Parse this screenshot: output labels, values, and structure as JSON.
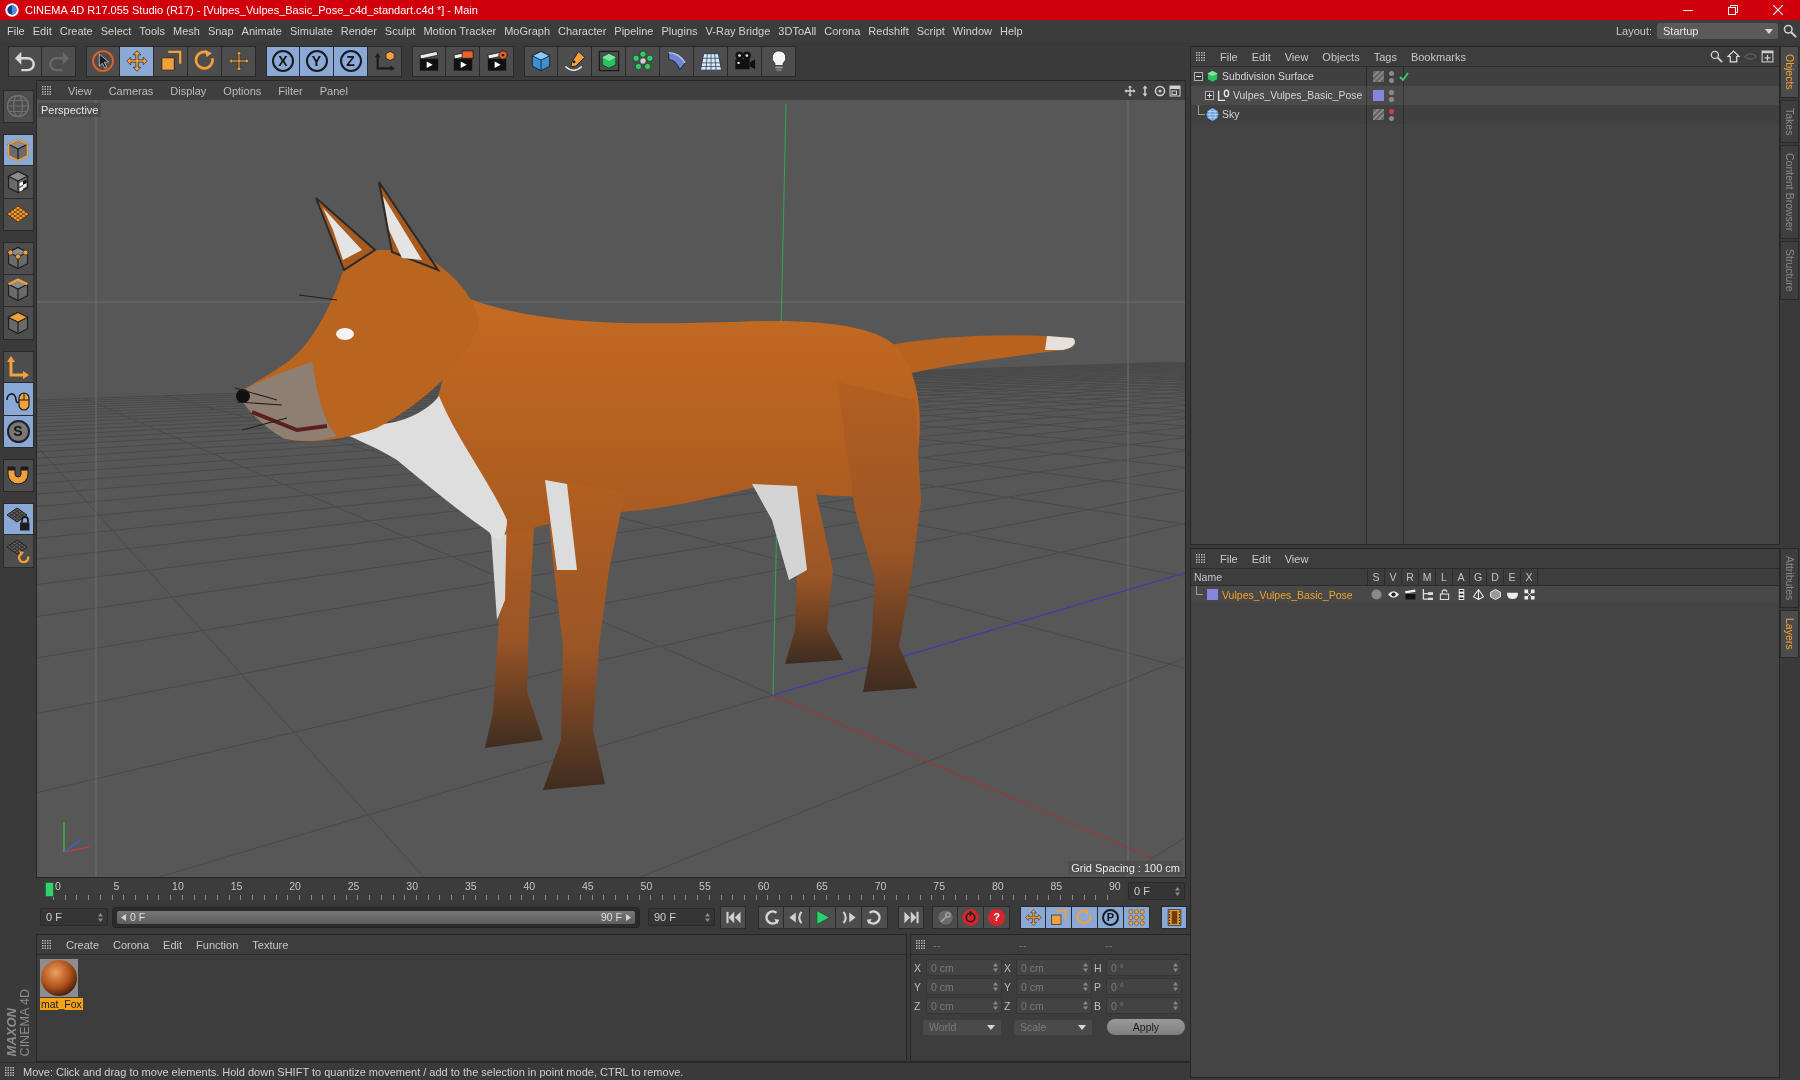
{
  "window": {
    "title": "CINEMA 4D R17.055 Studio (R17) - [Vulpes_Vulpes_Basic_Pose_c4d_standart.c4d *] - Main"
  },
  "menu_bar": [
    "File",
    "Edit",
    "Create",
    "Select",
    "Tools",
    "Mesh",
    "Snap",
    "Animate",
    "Simulate",
    "Render",
    "Sculpt",
    "Motion Tracker",
    "MoGraph",
    "Character",
    "Pipeline",
    "Plugins",
    "V-Ray Bridge",
    "3DToAll",
    "Corona",
    "Redshift",
    "Script",
    "Window",
    "Help"
  ],
  "layout": {
    "label": "Layout:",
    "value": "Startup"
  },
  "toolbar": [
    {
      "buttons": [
        {
          "selected": false,
          "disabled": false
        },
        {
          "selected": false,
          "disabled": true
        }
      ]
    },
    {
      "buttons": [
        {
          "selected": false
        },
        {
          "selected": true
        },
        {
          "selected": false
        },
        {
          "selected": false
        },
        {
          "selected": false
        }
      ]
    },
    {
      "buttons": [
        {
          "label": "X",
          "selected": true
        },
        {
          "label": "Y",
          "selected": true
        },
        {
          "label": "Z",
          "selected": true
        },
        {
          "selected": false
        }
      ]
    },
    {
      "buttons": [
        {
          "selected": false
        },
        {
          "selected": false
        },
        {
          "selected": false
        }
      ]
    },
    {
      "buttons": [
        {
          "selected": false
        },
        {
          "selected": false
        },
        {
          "selected": false
        },
        {
          "selected": false
        },
        {
          "selected": false
        },
        {
          "selected": false
        },
        {
          "selected": false
        },
        {
          "selected": false
        }
      ]
    }
  ],
  "mode_toolbar": [
    {
      "buttons": [
        {
          "selected": false,
          "disabled": true
        }
      ]
    },
    {
      "buttons": [
        {
          "selected": true
        },
        {
          "selected": false
        },
        {
          "selected": false
        }
      ]
    },
    {
      "buttons": [
        {
          "selected": false
        },
        {
          "selected": false
        },
        {
          "selected": false
        }
      ]
    },
    {
      "buttons": [
        {
          "selected": false
        },
        {
          "selected": true
        },
        {
          "label": "S",
          "selected": true
        }
      ]
    },
    {
      "buttons": [
        {
          "selected": false
        }
      ]
    },
    {
      "buttons": [
        {
          "selected": true
        },
        {
          "selected": false
        }
      ]
    }
  ],
  "brand": {
    "company": "MAXON",
    "product": "CINEMA 4D"
  },
  "viewport": {
    "menu": [
      "View",
      "Cameras",
      "Display",
      "Options",
      "Filter",
      "Panel"
    ],
    "camera": "Perspective",
    "grid_spacing": "Grid Spacing : 100 cm"
  },
  "timeline": {
    "ticks": [
      "0",
      "5",
      "10",
      "15",
      "20",
      "25",
      "30",
      "35",
      "40",
      "45",
      "50",
      "55",
      "60",
      "65",
      "70",
      "75",
      "80",
      "85",
      "90"
    ],
    "level": 0,
    "current_frame": "0 F"
  },
  "transport": {
    "start": "0 F",
    "range_start": "0 F",
    "range_end": "90 F",
    "end": "90 F",
    "level": 1,
    "groups": [
      {
        "buttons": [
          {
            "selected": false
          }
        ]
      },
      {
        "buttons": [
          {
            "selected": false
          },
          {
            "selected": false
          },
          {
            "selected": false
          },
          {
            "selected": false
          },
          {
            "selected": false
          }
        ]
      },
      {
        "buttons": [
          {
            "selected": false
          }
        ]
      },
      {
        "buttons": [
          {
            "selected": false
          },
          {
            "selected": false
          },
          {
            "label": "?",
            "selected": false
          }
        ]
      },
      {
        "buttons": [
          {
            "selected": true
          },
          {
            "selected": true
          },
          {
            "selected": true
          },
          {
            "label": "P",
            "selected": true
          },
          {
            "selected": true
          }
        ]
      },
      {
        "buttons": [
          {
            "selected": true
          }
        ]
      }
    ]
  },
  "materials": {
    "menu": [
      "Create",
      "Corona",
      "Edit",
      "Function",
      "Texture"
    ],
    "items": [
      {
        "name": "mat_Fox",
        "selected": true
      }
    ]
  },
  "coordinates": {
    "disabled": true,
    "columns": [
      "--",
      "--",
      "--"
    ],
    "rows": [
      {
        "axis": "X",
        "position": "0 cm",
        "size_axis": "X",
        "size": "0 cm",
        "rotation_axis": "H",
        "rotation": "0 °"
      },
      {
        "axis": "Y",
        "position": "0 cm",
        "size_axis": "Y",
        "size": "0 cm",
        "rotation_axis": "P",
        "rotation": "0 °"
      },
      {
        "axis": "Z",
        "position": "0 cm",
        "size_axis": "Z",
        "size": "0 cm",
        "rotation_axis": "B",
        "rotation": "0 °"
      }
    ],
    "mode": "World",
    "size_mode": "Scale",
    "apply": "Apply"
  },
  "status_bar": "Move: Click and drag to move elements. Hold down SHIFT to quantize movement / add to the selection in point mode, CTRL to remove.",
  "objects": {
    "menu": [
      "File",
      "Edit",
      "View",
      "Objects",
      "Tags",
      "Bookmarks"
    ],
    "tree": [
      {
        "name": "Subdivision Surface",
        "kind": "subdivision",
        "expanded": true,
        "editor_hidden": false,
        "enabled": true,
        "children": [
          {
            "name": "Vulpes_Vulpes_Basic_Pose",
            "kind": "null",
            "expanded": false,
            "editor_hidden": false,
            "color": "#8585de"
          }
        ]
      },
      {
        "name": "Sky",
        "kind": "sky",
        "editor_hidden": true
      }
    ]
  },
  "layers": {
    "menu": [
      "File",
      "Edit",
      "View"
    ],
    "columns": [
      "Name",
      "S",
      "V",
      "R",
      "M",
      "L",
      "A",
      "G",
      "D",
      "E",
      "X"
    ],
    "rows": [
      {
        "name": "Vulpes_Vulpes_Basic_Pose",
        "color": "#8585de",
        "selected": true
      }
    ]
  },
  "side_tabs": {
    "top": [
      {
        "label": "Objects",
        "selected": true
      },
      {
        "label": "Takes",
        "selected": false
      },
      {
        "label": "Content Browser",
        "selected": false
      },
      {
        "label": "Structure",
        "selected": false
      }
    ],
    "bottom": [
      {
        "label": "Attributes",
        "selected": false
      },
      {
        "label": "Layers",
        "selected": true
      }
    ]
  }
}
